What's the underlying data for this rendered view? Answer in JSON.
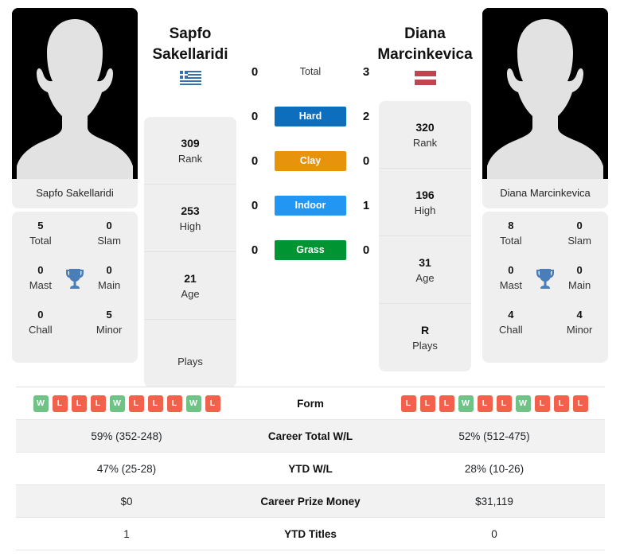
{
  "players": {
    "left": {
      "first_name": "Sapfo",
      "last_name": "Sakellaridi",
      "full_name": "Sapfo Sakellaridi",
      "flag_icon": "flag-greece-icon",
      "flag_country": "Greece",
      "rank": "309",
      "rank_label": "Rank",
      "high": "253",
      "high_label": "High",
      "age": "21",
      "age_label": "Age",
      "plays": "",
      "plays_label": "Plays",
      "titles": {
        "total_value": "5",
        "total_label": "Total",
        "slam_value": "0",
        "slam_label": "Slam",
        "mast_value": "0",
        "mast_label": "Mast",
        "main_value": "0",
        "main_label": "Main",
        "chall_value": "0",
        "chall_label": "Chall",
        "minor_value": "5",
        "minor_label": "Minor"
      },
      "form": [
        "W",
        "L",
        "L",
        "L",
        "W",
        "L",
        "L",
        "L",
        "W",
        "L"
      ],
      "career_total_wl": "59% (352-248)",
      "ytd_wl": "47% (25-28)",
      "career_prize_money": "$0",
      "ytd_titles": "1"
    },
    "right": {
      "first_name": "Diana",
      "last_name": "Marcinkevica",
      "full_name": "Diana Marcinkevica",
      "flag_icon": "flag-latvia-icon",
      "flag_country": "Latvia",
      "rank": "320",
      "rank_label": "Rank",
      "high": "196",
      "high_label": "High",
      "age": "31",
      "age_label": "Age",
      "plays": "R",
      "plays_label": "Plays",
      "titles": {
        "total_value": "8",
        "total_label": "Total",
        "slam_value": "0",
        "slam_label": "Slam",
        "mast_value": "0",
        "mast_label": "Mast",
        "main_value": "0",
        "main_label": "Main",
        "chall_value": "4",
        "chall_label": "Chall",
        "minor_value": "4",
        "minor_label": "Minor"
      },
      "form": [
        "L",
        "L",
        "L",
        "W",
        "L",
        "L",
        "W",
        "L",
        "L",
        "L"
      ],
      "career_total_wl": "52% (512-475)",
      "ytd_wl": "28% (10-26)",
      "career_prize_money": "$31,119",
      "ytd_titles": "0"
    }
  },
  "head_to_head": [
    {
      "label": "Total",
      "left": "0",
      "right": "3",
      "color": "",
      "style": "plain"
    },
    {
      "label": "Hard",
      "left": "0",
      "right": "2",
      "color": "#0d6ebd",
      "style": "pill"
    },
    {
      "label": "Clay",
      "left": "0",
      "right": "0",
      "color": "#e8930c",
      "style": "pill"
    },
    {
      "label": "Indoor",
      "left": "0",
      "right": "1",
      "color": "#2196f3",
      "style": "pill"
    },
    {
      "label": "Grass",
      "left": "0",
      "right": "0",
      "color": "#009432",
      "style": "pill"
    }
  ],
  "table_rows": [
    {
      "label": "Form",
      "type": "form",
      "left": "",
      "right": ""
    },
    {
      "label": "Career Total W/L",
      "type": "text",
      "left": "59% (352-248)",
      "right": "52% (512-475)"
    },
    {
      "label": "YTD W/L",
      "type": "text",
      "left": "47% (25-28)",
      "right": "28% (10-26)"
    },
    {
      "label": "Career Prize Money",
      "type": "text",
      "left": "$0",
      "right": "$31,119"
    },
    {
      "label": "YTD Titles",
      "type": "text",
      "left": "1",
      "right": "0"
    }
  ],
  "icons": {
    "trophy": "trophy-icon",
    "avatar": "player-photo-placeholder-icon"
  },
  "colors": {
    "hard": "#0d6ebd",
    "clay": "#e8930c",
    "indoor": "#2196f3",
    "grass": "#009432",
    "win_badge": "#71c286",
    "loss_badge": "#f2614c",
    "trophy": "#4a7eb8",
    "card_bg": "#efefef"
  }
}
